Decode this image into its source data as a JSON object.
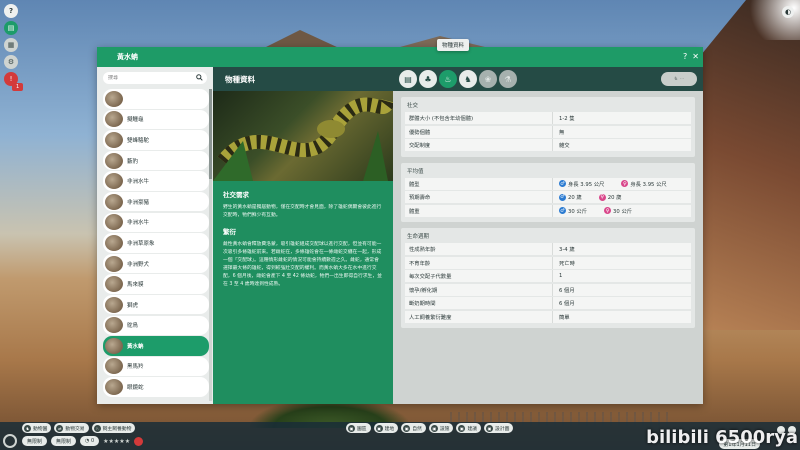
{
  "hud": {
    "help": "?",
    "alert_count": "1"
  },
  "window": {
    "title": "黃水蚺",
    "help_label": "?",
    "close_label": "✕",
    "tab_tooltip": "物種資料",
    "section_title": "物種資料",
    "search_placeholder": "搜尋"
  },
  "species": [
    {
      "name": ""
    },
    {
      "name": "擬鱷龜"
    },
    {
      "name": "雙峰駱駝"
    },
    {
      "name": "藪豹"
    },
    {
      "name": "非洲水牛"
    },
    {
      "name": "非洲豪豬"
    },
    {
      "name": "非洲水牛"
    },
    {
      "name": "非洲草原象"
    },
    {
      "name": "非洲野犬"
    },
    {
      "name": "馬來貘"
    },
    {
      "name": "獅虎"
    },
    {
      "name": "鴕鳥"
    },
    {
      "name": "黃水蚺"
    },
    {
      "name": "黑馬羚"
    },
    {
      "name": "眼鏡蛇"
    }
  ],
  "description": {
    "social_heading": "社交需求",
    "social_text": "野生的黃水蚺是獨居動物，僅在交配時才會見面，除了雄蛇偶爾會彼此進行交配時，牠們鮮少有互動。",
    "breeding_heading": "繁衍",
    "breeding_text": "雌性黃水蚺會釋放費洛蒙，吸引雄蛇組成交配球以進行交配，但並有可能一次吸引多條雄蛇前來。若雌蛇在，多條雄蛇會在一條雌蛇交纏在一起，形成一個「交配球」。這種情形雌蛇的情況可能會持續數週之久。雌蛇，通常會選擇最大條的雄蛇，得到較強壯交配的權利。而黃水蚺大多在水中進行交配，6 個月後，雌蛇會產下 4 至 42 條幼蛇，牠們一出生即得自行求生，並在 3 至 4 歲時達到性成熟。"
  },
  "stats": {
    "social": {
      "title": "社交",
      "rows": [
        {
          "label": "群體大小 (不包含年幼個體)",
          "value": "1-2 隻"
        },
        {
          "label": "優勢個體",
          "value": "無"
        },
        {
          "label": "交配制度",
          "value": "雜交"
        }
      ]
    },
    "average": {
      "title": "平均值",
      "rows": [
        {
          "label": "體型",
          "male": "身長 3.95 公尺",
          "female": "身長 3.95 公尺"
        },
        {
          "label": "預期壽命",
          "male": "20 歲",
          "female": "20 歲"
        },
        {
          "label": "體重",
          "male": "30 公斤",
          "female": "30 公斤"
        }
      ]
    },
    "reproduction": {
      "title": "生命週期",
      "rows": [
        {
          "label": "性成熟年齡",
          "value": "3-4 歲"
        },
        {
          "label": "不育年齡",
          "value": "死亡時"
        },
        {
          "label": "每次交配子代數量",
          "value": "1"
        },
        {
          "label": "懷孕/孵化期",
          "value": "6 個月"
        },
        {
          "label": "斷奶期時間",
          "value": "6 個月"
        },
        {
          "label": "人工飼養繁衍難度",
          "value": "簡單"
        }
      ]
    }
  },
  "bottom": {
    "btn_animals": "動物園",
    "btn_staff": "動物交易",
    "btn_guests": "飼主飼養動物",
    "center_buttons": [
      "園區",
      "建地",
      "自然",
      "設施",
      "建議",
      "設計圖"
    ],
    "money": "無限制",
    "money2": "無限制",
    "date": "第1年1月11日",
    "watermark": "6500rya"
  }
}
